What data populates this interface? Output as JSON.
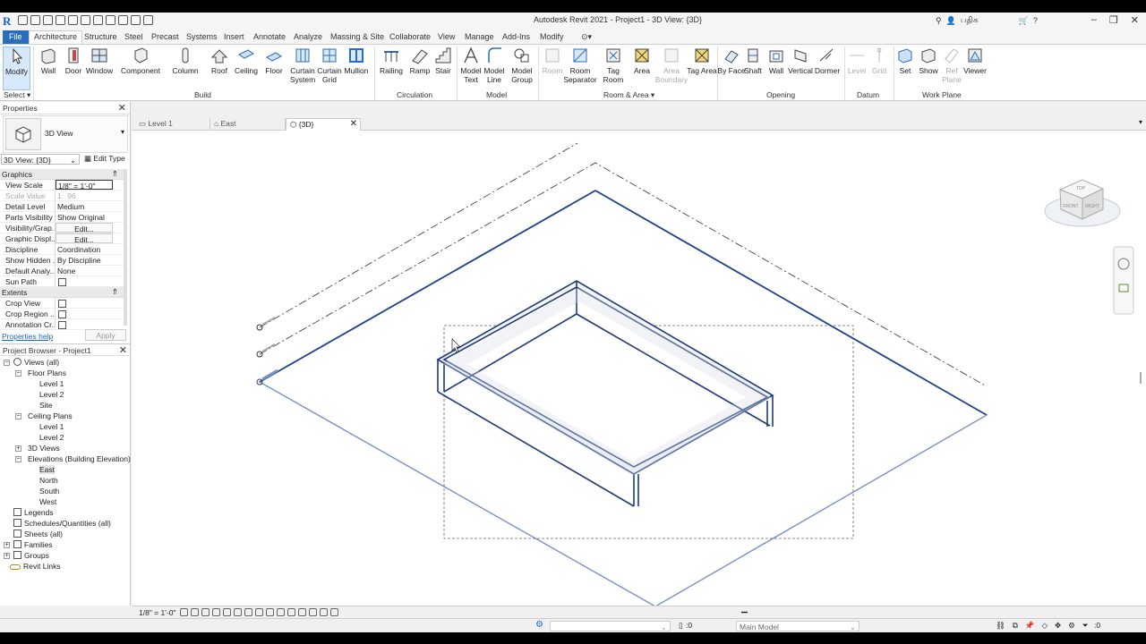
{
  "window": {
    "title": "Autodesk Revit 2021 - Project1 - 3D View: {3D}",
    "search_label": "பதிக"
  },
  "tabs": [
    "File",
    "Architecture",
    "Structure",
    "Steel",
    "Precast",
    "Systems",
    "Insert",
    "Annotate",
    "Analyze",
    "Massing & Site",
    "Collaborate",
    "View",
    "Manage",
    "Add-Ins",
    "Modify"
  ],
  "ribbon": {
    "modify": "Modify",
    "select": "Select",
    "build": {
      "label": "Build",
      "buttons": [
        "Wall",
        "Door",
        "Window",
        "Component",
        "Column",
        "Roof",
        "Ceiling",
        "Floor",
        "Curtain System",
        "Curtain Grid",
        "Mullion"
      ]
    },
    "circulation": {
      "label": "Circulation",
      "buttons": [
        "Railing",
        "Ramp",
        "Stair"
      ]
    },
    "model": {
      "label": "Model",
      "buttons": [
        "Model Text",
        "Model Line",
        "Model Group"
      ]
    },
    "room_area": {
      "label": "Room & Area",
      "buttons": [
        "Room",
        "Room Separator",
        "Tag Room",
        "Area",
        "Area Boundary",
        "Tag Area"
      ]
    },
    "opening": {
      "label": "Opening",
      "buttons": [
        "By Face",
        "Shaft",
        "Wall",
        "Vertical",
        "Dormer"
      ]
    },
    "datum": {
      "label": "Datum",
      "buttons": [
        "Level",
        "Grid"
      ]
    },
    "work_plane": {
      "label": "Work Plane",
      "buttons": [
        "Set",
        "Show",
        "Ref Plane",
        "Viewer"
      ]
    }
  },
  "properties": {
    "header": "Properties",
    "type_name": "3D View",
    "view_selector": "3D View: {3D}",
    "edit_type": "Edit Type",
    "sections": {
      "graphics": "Graphics",
      "extents": "Extents"
    },
    "rows": [
      {
        "k": "View Scale",
        "v": "1/8\" = 1'-0\""
      },
      {
        "k": "Scale Value",
        "v": "96"
      },
      {
        "k": "Detail Level",
        "v": "Medium"
      },
      {
        "k": "Parts Visibility",
        "v": "Show Original"
      },
      {
        "k": "Visibility/Grap...",
        "v": "Edit..."
      },
      {
        "k": "Graphic Displ...",
        "v": "Edit..."
      },
      {
        "k": "Discipline",
        "v": "Coordination"
      },
      {
        "k": "Show Hidden ...",
        "v": "By Discipline"
      },
      {
        "k": "Default Analy...",
        "v": "None"
      },
      {
        "k": "Sun Path",
        "v": ""
      }
    ],
    "extent_rows": [
      {
        "k": "Crop View"
      },
      {
        "k": "Crop Region ..."
      },
      {
        "k": "Annotation Cr..."
      }
    ],
    "help": "Properties help",
    "apply": "Apply"
  },
  "browser": {
    "header": "Project Browser - Project1",
    "items": [
      "Views (all)",
      "Floor Plans",
      "Level 1",
      "Level 2",
      "Site",
      "Ceiling Plans",
      "Level 1",
      "Level 2",
      "3D Views",
      "Elevations (Building Elevation)",
      "East",
      "North",
      "South",
      "West",
      "Legends",
      "Schedules/Quantities (all)",
      "Sheets (all)",
      "Families",
      "Groups",
      "Revit Links"
    ]
  },
  "view_tabs": [
    "Level 1",
    "East",
    "{3D}"
  ],
  "viewcube": {
    "top": "TOP",
    "front": "FRONT",
    "right": "RIGHT"
  },
  "view_control": {
    "scale": "1/8\" = 1'-0\""
  },
  "status": {
    "zero": ":0",
    "model": "Main Model",
    "filter": ":0"
  }
}
